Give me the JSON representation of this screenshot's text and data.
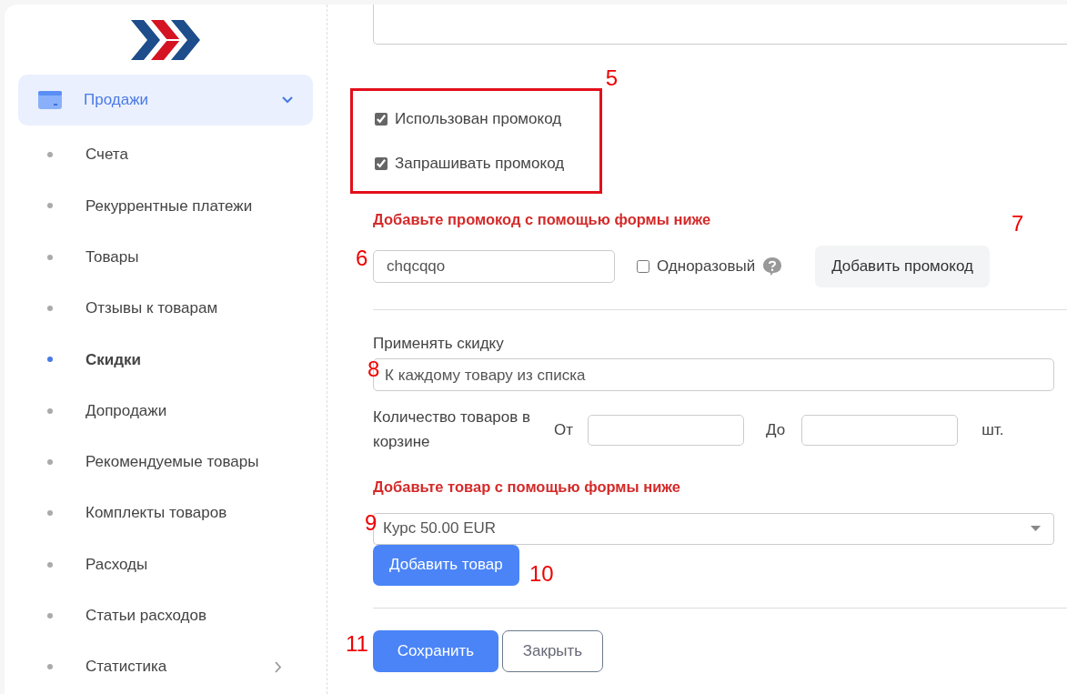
{
  "sidebar": {
    "active_group": {
      "label": "Продажи",
      "expanded": true
    },
    "items": [
      {
        "label": "Счета",
        "selected": false
      },
      {
        "label": "Рекуррентные платежи",
        "selected": false
      },
      {
        "label": "Товары",
        "selected": false
      },
      {
        "label": "Отзывы к товарам",
        "selected": false
      },
      {
        "label": "Скидки",
        "selected": true
      },
      {
        "label": "Допродажи",
        "selected": false
      },
      {
        "label": "Рекомендуемые товары",
        "selected": false
      },
      {
        "label": "Комплекты товаров",
        "selected": false
      },
      {
        "label": "Расходы",
        "selected": false
      },
      {
        "label": "Статьи расходов",
        "selected": false
      },
      {
        "label": "Статистика",
        "selected": false,
        "has_children": true
      }
    ]
  },
  "form": {
    "checkboxes": {
      "marker": "5",
      "items": [
        {
          "label": "Использован промокод",
          "checked": true
        },
        {
          "label": "Запрашивать промокод",
          "checked": true
        }
      ]
    },
    "promo_hint": "Добавьте промокод с помощью формы ниже",
    "promo": {
      "marker": "6",
      "value": "chqcqqo",
      "single_use": {
        "label": "Одноразовый",
        "checked": false
      },
      "button": "Добавить промокод",
      "button_marker": "7"
    },
    "apply": {
      "label": "Применять скидку",
      "value": "К каждому товару из списка",
      "marker": "8"
    },
    "quantity": {
      "label": "Количество товаров в корзине",
      "from": "От",
      "to": "До",
      "unit": "шт."
    },
    "product_hint": "Добавьте товар с помощью формы ниже",
    "product": {
      "value": "Курс 50.00 EUR",
      "marker": "9",
      "button": "Добавить товар",
      "button_marker": "10"
    },
    "save": "Сохранить",
    "save_marker": "11",
    "close": "Закрыть"
  }
}
